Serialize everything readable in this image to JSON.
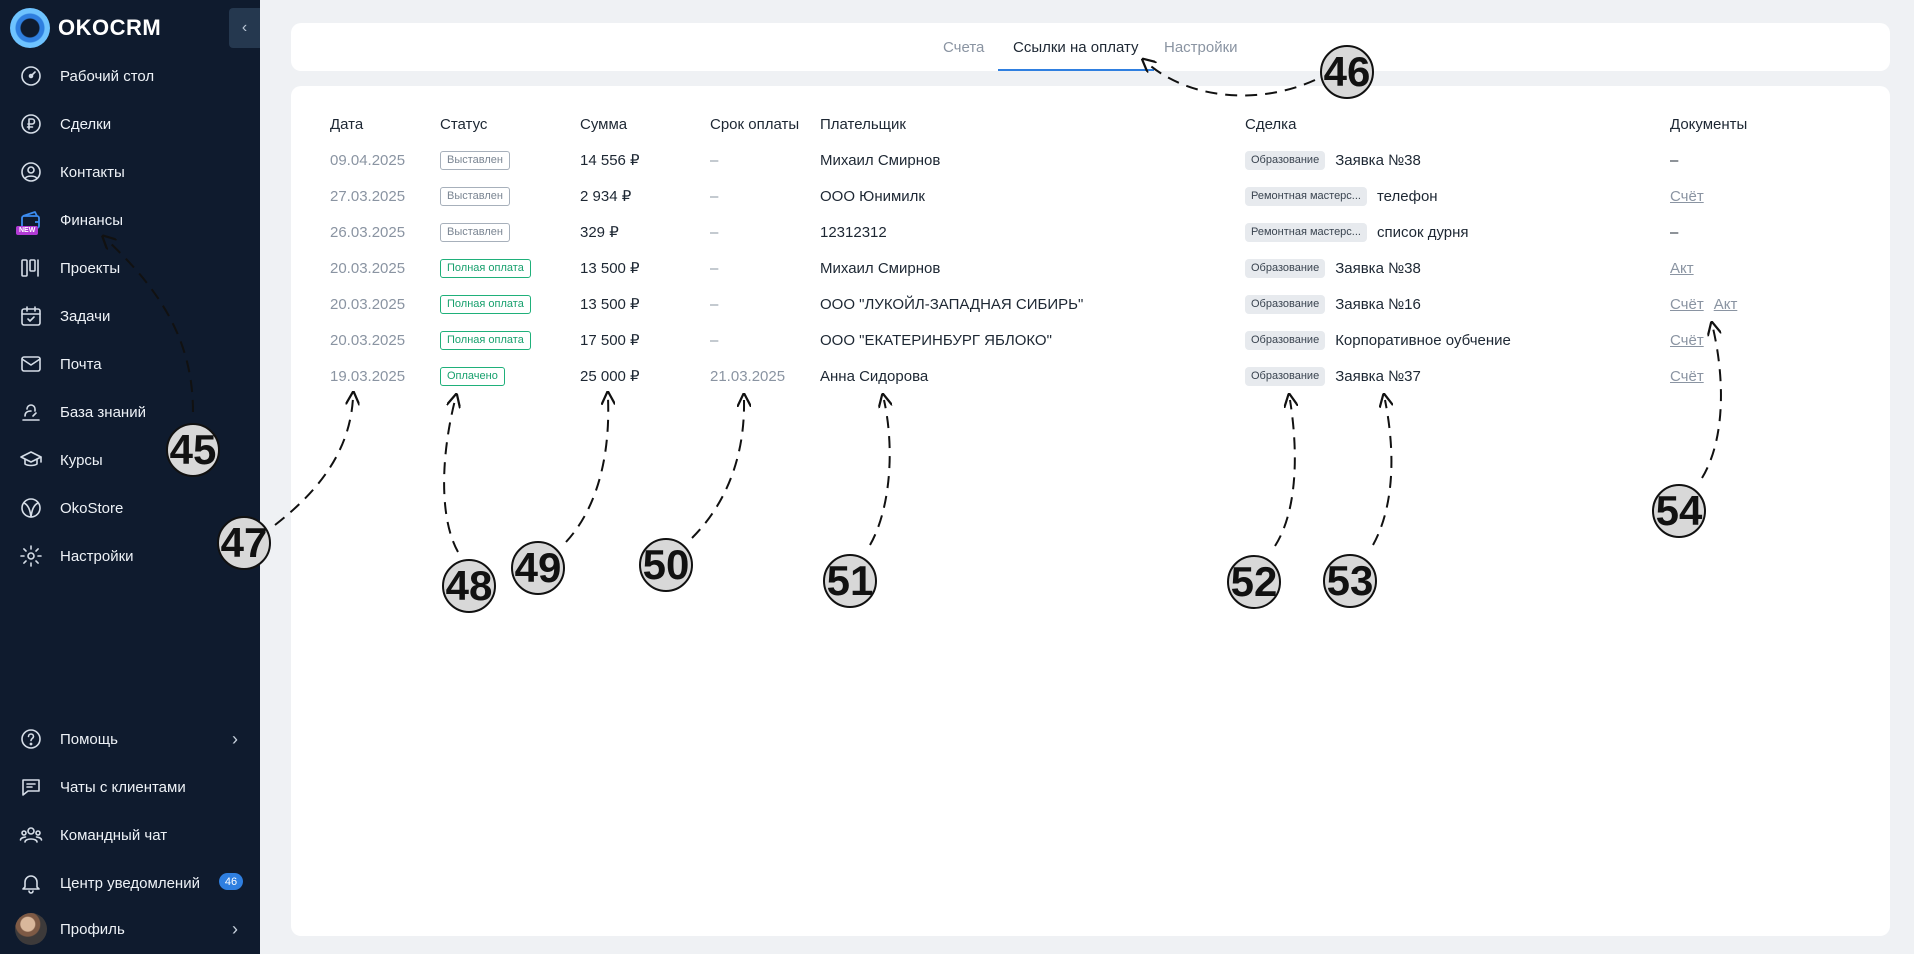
{
  "app": {
    "name": "OKOCRM"
  },
  "sidebar": {
    "items": [
      {
        "label": "Рабочий стол",
        "icon": "dashboard-icon"
      },
      {
        "label": "Сделки",
        "icon": "ruble-icon"
      },
      {
        "label": "Контакты",
        "icon": "contact-icon"
      },
      {
        "label": "Финансы",
        "icon": "finance-icon",
        "badge": "NEW"
      },
      {
        "label": "Проекты",
        "icon": "projects-icon"
      },
      {
        "label": "Задачи",
        "icon": "calendar-icon"
      },
      {
        "label": "Почта",
        "icon": "mail-icon"
      },
      {
        "label": "База знаний",
        "icon": "knowledge-icon"
      },
      {
        "label": "Курсы",
        "icon": "graduation-cap-icon"
      },
      {
        "label": "OkoStore",
        "icon": "store-icon"
      },
      {
        "label": "Настройки",
        "icon": "gear-icon"
      }
    ],
    "bottom": [
      {
        "label": "Помощь",
        "icon": "help-icon"
      },
      {
        "label": "Чаты с клиентами",
        "icon": "chat-icon"
      },
      {
        "label": "Командный чат",
        "icon": "team-icon"
      },
      {
        "label": "Центр уведомлений",
        "icon": "bell-icon",
        "count": "46"
      },
      {
        "label": "Профиль",
        "icon": "avatar"
      }
    ]
  },
  "tabs": [
    {
      "label": "Счета"
    },
    {
      "label": "Ссылки на оплату",
      "active": true
    },
    {
      "label": "Настройки"
    }
  ],
  "table": {
    "headers": {
      "date": "Дата",
      "status": "Статус",
      "sum": "Сумма",
      "due": "Срок оплаты",
      "payer": "Плательщик",
      "deal": "Сделка",
      "docs": "Документы"
    },
    "rows": [
      {
        "date": "09.04.2025",
        "status": "Выставлен",
        "status_color": "gray",
        "sum": "14 556 ₽",
        "due": "–",
        "payer": "Михаил Смирнов",
        "deal_tag": "Образование",
        "deal_name": "Заявка №38",
        "docs": [],
        "docs_empty": "–"
      },
      {
        "date": "27.03.2025",
        "status": "Выставлен",
        "status_color": "gray",
        "sum": "2 934 ₽",
        "due": "–",
        "payer": "ООО Юнимилк",
        "deal_tag": "Ремонтная мастерс...",
        "deal_name": "телефон",
        "docs": [
          "Счёт"
        ]
      },
      {
        "date": "26.03.2025",
        "status": "Выставлен",
        "status_color": "gray",
        "sum": "329 ₽",
        "due": "–",
        "payer": "12312312",
        "deal_tag": "Ремонтная мастерс...",
        "deal_name": "список дурня",
        "docs": [],
        "docs_empty": "–"
      },
      {
        "date": "20.03.2025",
        "status": "Полная оплата",
        "status_color": "green",
        "sum": "13 500 ₽",
        "due": "–",
        "payer": "Михаил Смирнов",
        "deal_tag": "Образование",
        "deal_name": "Заявка №38",
        "docs": [
          "Акт"
        ]
      },
      {
        "date": "20.03.2025",
        "status": "Полная оплата",
        "status_color": "green",
        "sum": "13 500 ₽",
        "due": "–",
        "payer": "ООО \"ЛУКОЙЛ-ЗАПАДНАЯ СИБИРЬ\"",
        "deal_tag": "Образование",
        "deal_name": "Заявка №16",
        "docs": [
          "Счёт",
          "Акт"
        ]
      },
      {
        "date": "20.03.2025",
        "status": "Полная оплата",
        "status_color": "green",
        "sum": "17 500 ₽",
        "due": "–",
        "payer": "ООО \"ЕКАТЕРИНБУРГ ЯБЛОКО\"",
        "deal_tag": "Образование",
        "deal_name": "Корпоративное оубчение",
        "docs": [
          "Счёт"
        ]
      },
      {
        "date": "19.03.2025",
        "status": "Оплачено",
        "status_color": "green",
        "sum": "25 000 ₽",
        "due": "21.03.2025",
        "payer": "Анна Сидорова",
        "deal_tag": "Образование",
        "deal_name": "Заявка №37",
        "docs": [
          "Счёт"
        ]
      }
    ]
  },
  "annotations": [
    "45",
    "46",
    "47",
    "48",
    "49",
    "50",
    "51",
    "52",
    "53",
    "54"
  ]
}
